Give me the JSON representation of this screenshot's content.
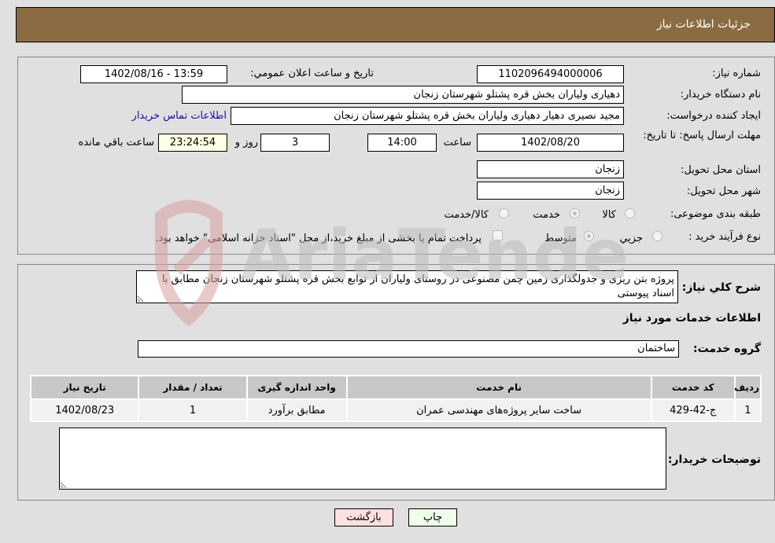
{
  "header": {
    "title": "جزئیات اطلاعات نیاز"
  },
  "form": {
    "need_number": {
      "label": "شماره نیاز:",
      "value": "1102096494000006"
    },
    "announce_datetime": {
      "label": "تاریخ و ساعت اعلان عمومي:",
      "value": "1402/08/16 - 13:59"
    },
    "buyer_org": {
      "label": "نام دستگاه خریدار:",
      "value": "دهیاری ولیاران بخش قره پشتلو شهرستان زنجان"
    },
    "requester": {
      "label": "ایجاد کننده درخواست:",
      "value": "مجید نصیری دهیار دهیاری ولیاران بخش قره پشتلو شهرستان زنجان"
    },
    "buyer_contact_link": "اطلاعات تماس خریدار",
    "deadline": {
      "label": "مهلت ارسال پاسخ: تا تاریخ:",
      "date": "1402/08/20",
      "time_label": "ساعت",
      "time": "14:00",
      "days": "3",
      "days_label": "روز و",
      "remaining": "23:24:54",
      "remaining_label": "ساعت باقي مانده"
    },
    "province": {
      "label": "استان محل تحویل:",
      "value": "زنجان"
    },
    "city": {
      "label": "شهر محل تحویل:",
      "value": "زنجان"
    },
    "category": {
      "label": "طبقه بندی موضوعی:",
      "options": [
        {
          "label": "کالا",
          "checked": false
        },
        {
          "label": "خدمت",
          "checked": true
        },
        {
          "label": "کالا/خدمت",
          "checked": false
        }
      ]
    },
    "purchase_type": {
      "label": "نوع فرآیند خرید :",
      "options": [
        {
          "label": "جزيي",
          "checked": false
        },
        {
          "label": "متوسط",
          "checked": true
        }
      ],
      "treasury_note": "پرداخت تمام یا بخشی از مبلغ خرید،از محل \"اسناد خزانه اسلامی\" خواهد بود."
    }
  },
  "details": {
    "description_label": "شرح کلي نياز:",
    "description": "پروژه بتن ریزی و جدولگذاری زمین چمن مصنوعی در روستای ولیاران از توابع بخش قره پشتلو شهرستان زنجان مطابق با اسناد پیوستی",
    "services_heading": "اطلاعات خدمات مورد نياز",
    "service_group_label": "گروه خدمت:",
    "service_group": "ساختمان",
    "table": {
      "headers": [
        "رديف",
        "کد خدمت",
        "نام خدمت",
        "واحد اندازه گيری",
        "تعداد / مقدار",
        "تاريخ نياز"
      ],
      "rows": [
        [
          "1",
          "ج-42-429",
          "ساخت سایر پروژه‌های مهندسی عمران",
          "مطابق برآورد",
          "1",
          "1402/08/23"
        ]
      ]
    },
    "buyer_notes_label": "توضیحات خریدار:",
    "buyer_notes": ""
  },
  "buttons": {
    "print": "چاپ",
    "back": "بازگشت"
  },
  "watermark": {
    "text": "AriaTender.neT"
  },
  "colors": {
    "header_bg": "#8b6c42",
    "page_bg": "#e0e0e0",
    "link": "#1a0dab"
  }
}
